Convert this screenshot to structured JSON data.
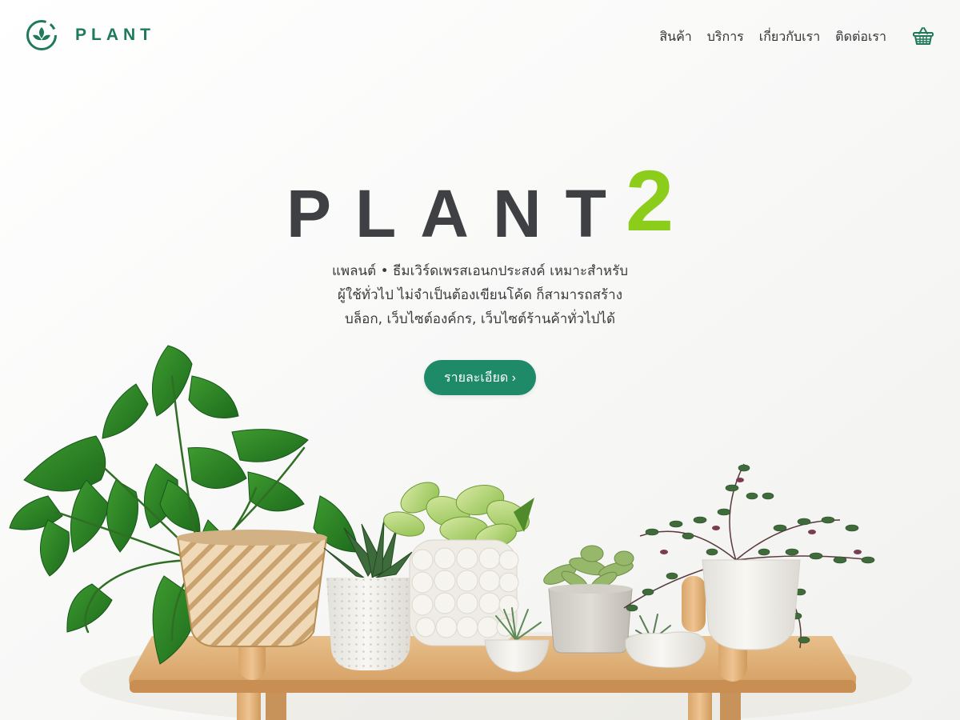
{
  "brand": {
    "name": "PLANT",
    "logo_icon": "leaf-circle-icon",
    "color": "#1e7a5a"
  },
  "nav": {
    "items": [
      {
        "label": "สินค้า"
      },
      {
        "label": "บริการ"
      },
      {
        "label": "เกี่ยวกับเรา"
      },
      {
        "label": "ติดต่อเรา"
      }
    ],
    "cart_icon": "shopping-basket-icon"
  },
  "hero": {
    "title_word": "PLANT",
    "title_number": "2",
    "title_color": "#3f4043",
    "number_color": "#8ccc1a",
    "subtitle_lines": [
      "แพลนต์ • ธีมเวิร์ดเพรสเอนกประสงค์ เหมาะสำหรับ",
      "ผู้ใช้ทั่วไป ไม่จำเป็นต้องเขียนโค้ด ก็สามารถสร้าง",
      "บล็อก, เว็บไซต์องค์กร, เว็บไซต์ร้านค้าทั่วไปได้"
    ],
    "cta_label": "รายละเอียด ›",
    "cta_color": "#1f8a68"
  }
}
